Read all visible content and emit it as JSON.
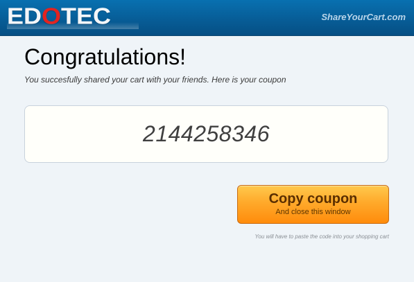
{
  "header": {
    "logo_letters": [
      {
        "char": "E",
        "red": false
      },
      {
        "char": "D",
        "red": false
      },
      {
        "char": "O",
        "red": true
      },
      {
        "char": "T",
        "red": false
      },
      {
        "char": "E",
        "red": false
      },
      {
        "char": "C",
        "red": false
      }
    ],
    "logo_text": "EDOTEC",
    "site_link": "ShareYourCart.com"
  },
  "main": {
    "title": "Congratulations!",
    "subtitle": "You succesfully shared your cart with your friends. Here is your coupon",
    "coupon_code": "2144258346"
  },
  "copy_button": {
    "label": "Copy coupon",
    "sublabel": "And close this window"
  },
  "hint": "You will have to paste the code into your shopping cart",
  "colors": {
    "header_bg": "#075d97",
    "logo_accent": "#e22320",
    "button_orange": "#ff9a1c",
    "page_bg": "#eff4f8"
  }
}
